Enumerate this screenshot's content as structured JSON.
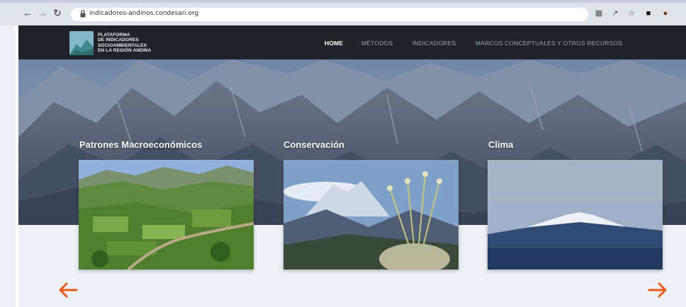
{
  "browser": {
    "url": "indicadores-andinos.condesan.org",
    "icons": [
      "back-icon",
      "forward-icon",
      "reload-icon",
      "lock-icon",
      "translate-icon",
      "share-icon",
      "star-icon",
      "window-icon",
      "profile-icon"
    ]
  },
  "site": {
    "logo_lines": [
      "PLATAFORMA",
      "DE INDICADORES",
      "SOCIOAMBIENTALES",
      "EN LA REGIÓN ANDINA"
    ],
    "menu": [
      {
        "label": "HOME",
        "active": true
      },
      {
        "label": "MÉTODOS",
        "active": false
      },
      {
        "label": "INDICADORES",
        "active": false
      },
      {
        "label": "MARCOS CONCEPTUALES Y OTROS RECURSOS",
        "active": false
      }
    ],
    "accent_color": "#e8591a"
  },
  "cards": [
    {
      "title": "Patrones Macroeconómicos",
      "image": "valley-landscape"
    },
    {
      "title": "Conservación",
      "image": "paramo-frailejon"
    },
    {
      "title": "Clima",
      "image": "snow-volcano"
    }
  ],
  "carousel": {
    "prev": "arrow-left-icon",
    "next": "arrow-right-icon"
  }
}
